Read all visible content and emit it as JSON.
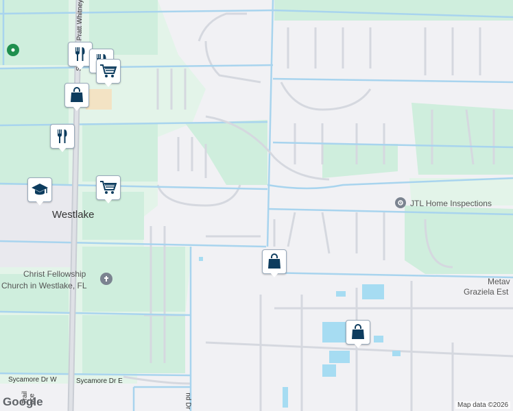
{
  "colors": {
    "park": "#cfeedd",
    "urban": "#f1f1f4",
    "road_major": "#a8d4ee",
    "road_minor": "#cfd3dc",
    "water": "#a6dcf2",
    "pin_fill": "#0d3c5e",
    "commercial": "#f3e3c4"
  },
  "places": {
    "town": "Westlake",
    "church_line1": "Christ Fellowship",
    "church_line2": "Church in Westlake, FL",
    "business": "JTL Home Inspections",
    "area_line1": "Metav",
    "area_line2": "Graziela Est"
  },
  "streets": {
    "seminole": "Seminole Pratt Whitney",
    "sycamore_w": "Sycamore Dr W",
    "sycamore_e": "Sycamore Dr E",
    "trail_a": "Trail",
    "trail_b": "ace",
    "bottom_dr": "nd Dr"
  },
  "pins": [
    {
      "icon": "restaurant-icon"
    },
    {
      "icon": "restaurant-icon"
    },
    {
      "icon": "grocery-cart-icon"
    },
    {
      "icon": "shopping-bag-icon"
    },
    {
      "icon": "restaurant-icon"
    },
    {
      "icon": "school-icon"
    },
    {
      "icon": "grocery-cart-icon"
    },
    {
      "icon": "shopping-bag-icon"
    },
    {
      "icon": "shopping-bag-icon"
    }
  ],
  "attribution": {
    "logo": "Google",
    "text": "Map data ©2026"
  }
}
